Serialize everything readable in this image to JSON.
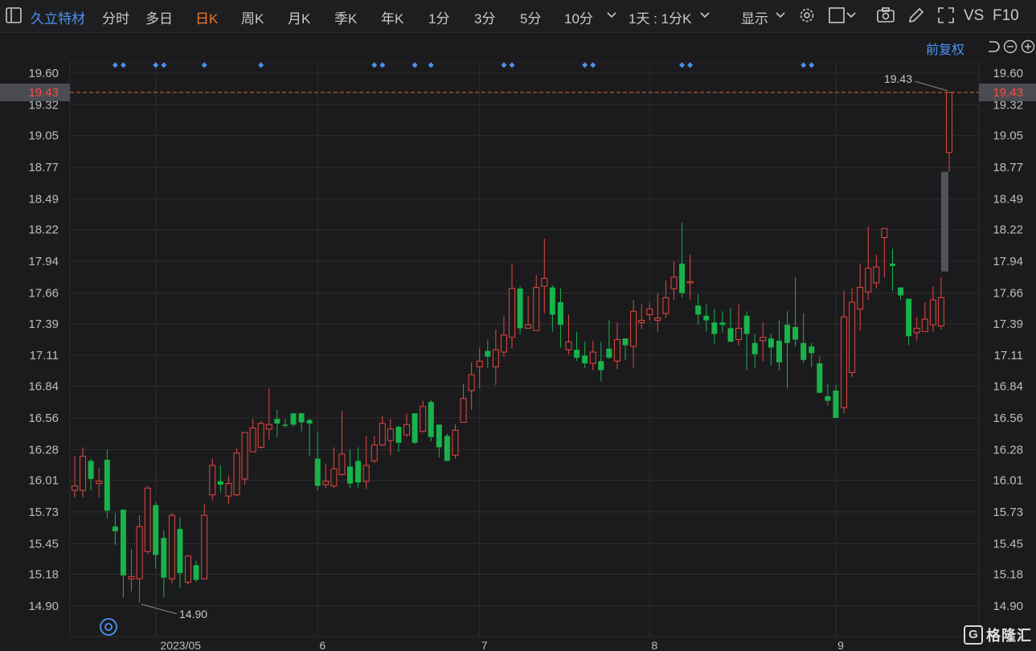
{
  "toolbar": {
    "stock_name": "久立特材",
    "tabs": [
      {
        "label": "分时",
        "active": false
      },
      {
        "label": "多日",
        "active": false
      },
      {
        "label": "日K",
        "active": true
      },
      {
        "label": "周K",
        "active": false
      },
      {
        "label": "月K",
        "active": false
      },
      {
        "label": "季K",
        "active": false
      },
      {
        "label": "年K",
        "active": false
      },
      {
        "label": "1分",
        "active": false
      },
      {
        "label": "3分",
        "active": false
      },
      {
        "label": "5分",
        "active": false
      },
      {
        "label": "10分",
        "active": false
      }
    ],
    "period_select": "1天 : 1分K",
    "display_label": "显示",
    "vs_label": "VS",
    "f10_label": "F10",
    "icons": [
      "sidebar-toggle-icon",
      "chevron-down-icon",
      "settings-gear-icon",
      "rectangle-icon",
      "camera-icon",
      "pencil-icon",
      "fullscreen-icon"
    ]
  },
  "subbar": {
    "adjust_label": "前复权",
    "icons": [
      "undo-icon",
      "zoom-out-icon",
      "zoom-in-icon"
    ]
  },
  "brand": {
    "mark": "G",
    "text": "格隆汇"
  },
  "colors": {
    "up": "#e5473d",
    "down": "#18b34a",
    "bg": "#1b1b1d",
    "grid": "#2e2e31",
    "accent": "#4b93f0",
    "price_line": "#e0683a"
  },
  "chart_data": {
    "type": "candlestick",
    "price_axis_ticks": [
      "19.60",
      "19.32",
      "19.05",
      "18.77",
      "18.49",
      "18.22",
      "17.94",
      "17.66",
      "17.39",
      "17.11",
      "16.84",
      "16.56",
      "16.28",
      "16.01",
      "15.73",
      "15.45",
      "15.18",
      "14.90"
    ],
    "ylim": [
      14.9,
      19.6
    ],
    "x_ticks": [
      {
        "label": "2023/05",
        "index": 10
      },
      {
        "label": "6",
        "index": 30
      },
      {
        "label": "7",
        "index": 50
      },
      {
        "label": "8",
        "index": 71
      },
      {
        "label": "9",
        "index": 94
      }
    ],
    "current_price": "19.43",
    "max_label": "19.43",
    "min_label": "14.90",
    "event_marker_count": 10,
    "candles": [
      [
        15.92,
        15.96,
        16.22,
        15.86
      ],
      [
        15.92,
        16.22,
        16.3,
        15.86
      ],
      [
        16.18,
        16.02,
        16.2,
        15.92
      ],
      [
        15.98,
        16.0,
        16.12,
        15.86
      ],
      [
        16.19,
        15.74,
        16.28,
        15.67
      ],
      [
        15.6,
        15.56,
        15.72,
        15.44
      ],
      [
        15.75,
        15.17,
        15.75,
        14.97
      ],
      [
        15.14,
        15.16,
        15.4,
        15.03
      ],
      [
        15.14,
        15.6,
        15.7,
        14.93
      ],
      [
        15.38,
        15.94,
        15.96,
        15.36
      ],
      [
        15.79,
        15.35,
        15.82,
        15.23
      ],
      [
        15.5,
        15.15,
        15.57,
        14.98
      ],
      [
        15.14,
        15.7,
        15.72,
        15.1
      ],
      [
        15.58,
        15.19,
        15.68,
        15.06
      ],
      [
        15.11,
        15.34,
        15.35,
        15.09
      ],
      [
        15.26,
        15.13,
        15.3,
        15.11
      ],
      [
        15.14,
        15.7,
        15.8,
        15.14
      ],
      [
        15.88,
        16.14,
        16.2,
        15.83
      ],
      [
        16.0,
        15.97,
        16.14,
        15.9
      ],
      [
        15.87,
        15.98,
        16.05,
        15.8
      ],
      [
        15.88,
        16.25,
        16.29,
        15.87
      ],
      [
        16.02,
        16.43,
        16.43,
        15.97
      ],
      [
        16.26,
        16.47,
        16.55,
        16.26
      ],
      [
        16.3,
        16.51,
        16.53,
        16.29
      ],
      [
        16.46,
        16.5,
        16.82,
        16.37
      ],
      [
        16.55,
        16.51,
        16.63,
        16.39
      ],
      [
        16.5,
        16.49,
        16.55,
        16.47
      ],
      [
        16.6,
        16.5,
        16.6,
        16.48
      ],
      [
        16.6,
        16.52,
        16.6,
        16.44
      ],
      [
        16.54,
        16.51,
        16.55,
        16.22
      ],
      [
        16.2,
        15.96,
        16.44,
        15.92
      ],
      [
        15.97,
        16.0,
        16.15,
        15.94
      ],
      [
        15.96,
        16.11,
        16.3,
        15.94
      ],
      [
        16.06,
        16.24,
        16.62,
        16.05
      ],
      [
        16.13,
        15.98,
        16.28,
        15.94
      ],
      [
        16.18,
        15.99,
        16.3,
        15.94
      ],
      [
        16.0,
        16.14,
        16.4,
        15.93
      ],
      [
        16.18,
        16.32,
        16.4,
        16.16
      ],
      [
        16.32,
        16.51,
        16.58,
        16.31
      ],
      [
        16.36,
        16.46,
        16.55,
        16.23
      ],
      [
        16.48,
        16.34,
        16.49,
        16.26
      ],
      [
        16.41,
        16.5,
        16.6,
        16.39
      ],
      [
        16.6,
        16.34,
        16.6,
        16.33
      ],
      [
        16.44,
        16.66,
        16.71,
        16.43
      ],
      [
        16.7,
        16.39,
        16.72,
        16.35
      ],
      [
        16.5,
        16.3,
        16.5,
        16.21
      ],
      [
        16.4,
        16.18,
        16.42,
        16.18
      ],
      [
        16.23,
        16.45,
        16.5,
        16.2
      ],
      [
        16.52,
        16.73,
        16.86,
        16.52
      ],
      [
        16.8,
        16.94,
        17.05,
        16.63
      ],
      [
        17.01,
        17.06,
        17.18,
        16.82
      ],
      [
        17.15,
        17.1,
        17.25,
        17.0
      ],
      [
        17.01,
        17.16,
        17.34,
        16.85
      ],
      [
        17.14,
        17.29,
        17.46,
        17.1
      ],
      [
        17.27,
        17.7,
        17.92,
        17.17
      ],
      [
        17.7,
        17.35,
        17.72,
        17.3
      ],
      [
        17.35,
        17.38,
        17.63,
        17.35
      ],
      [
        17.33,
        17.71,
        17.82,
        17.33
      ],
      [
        17.72,
        17.79,
        18.14,
        17.48
      ],
      [
        17.71,
        17.47,
        17.73,
        17.32
      ],
      [
        17.58,
        17.38,
        17.7,
        17.18
      ],
      [
        17.16,
        17.23,
        17.47,
        17.12
      ],
      [
        17.16,
        17.09,
        17.32,
        17.06
      ],
      [
        17.11,
        17.04,
        17.23,
        17.0
      ],
      [
        17.04,
        17.14,
        17.24,
        16.98
      ],
      [
        17.06,
        16.98,
        17.23,
        16.88
      ],
      [
        17.17,
        17.09,
        17.42,
        17.08
      ],
      [
        17.06,
        17.25,
        17.4,
        16.99
      ],
      [
        17.26,
        17.2,
        17.25,
        17.07
      ],
      [
        17.19,
        17.5,
        17.6,
        17.0
      ],
      [
        17.4,
        17.42,
        17.56,
        17.34
      ],
      [
        17.47,
        17.52,
        17.57,
        17.42
      ],
      [
        17.42,
        17.44,
        17.66,
        17.32
      ],
      [
        17.48,
        17.62,
        17.77,
        17.44
      ],
      [
        17.7,
        17.8,
        17.94,
        17.6
      ],
      [
        17.92,
        17.66,
        18.28,
        17.62
      ],
      [
        17.75,
        17.76,
        18.0,
        17.6
      ],
      [
        17.55,
        17.47,
        17.65,
        17.38
      ],
      [
        17.46,
        17.42,
        17.56,
        17.32
      ],
      [
        17.4,
        17.3,
        17.52,
        17.21
      ],
      [
        17.4,
        17.38,
        17.5,
        17.31
      ],
      [
        17.35,
        17.23,
        17.53,
        17.25
      ],
      [
        17.25,
        17.35,
        17.56,
        17.2
      ],
      [
        17.46,
        17.3,
        17.5,
        16.98
      ],
      [
        17.22,
        17.12,
        17.3,
        17.0
      ],
      [
        17.24,
        17.27,
        17.4,
        17.06
      ],
      [
        17.26,
        17.18,
        17.3,
        17.02
      ],
      [
        17.24,
        17.05,
        17.42,
        16.98
      ],
      [
        17.38,
        17.22,
        17.5,
        16.82
      ],
      [
        17.36,
        17.25,
        17.8,
        17.19
      ],
      [
        17.22,
        17.07,
        17.48,
        17.04
      ],
      [
        17.19,
        17.13,
        17.22,
        17.01
      ],
      [
        17.04,
        16.78,
        17.1,
        16.85
      ],
      [
        16.75,
        16.71,
        16.86,
        16.67
      ],
      [
        16.8,
        16.56,
        16.85,
        16.6
      ],
      [
        16.65,
        17.45,
        17.68,
        16.6
      ],
      [
        16.96,
        17.58,
        17.7,
        16.92
      ],
      [
        17.52,
        17.71,
        17.92,
        17.33
      ],
      [
        17.67,
        17.88,
        18.25,
        17.6
      ],
      [
        17.75,
        17.89,
        18.0,
        17.7
      ],
      [
        18.15,
        18.23,
        18.23,
        17.8
      ],
      [
        17.92,
        17.9,
        18.05,
        17.68
      ],
      [
        17.71,
        17.64,
        17.68,
        17.6
      ],
      [
        17.61,
        17.28,
        17.61,
        17.2
      ],
      [
        17.31,
        17.35,
        17.45,
        17.24
      ],
      [
        17.32,
        17.43,
        17.58,
        17.34
      ],
      [
        17.38,
        17.6,
        17.72,
        17.32
      ],
      [
        17.37,
        17.62,
        17.8,
        17.34
      ],
      [
        18.9,
        19.43,
        19.43,
        18.73
      ]
    ]
  }
}
